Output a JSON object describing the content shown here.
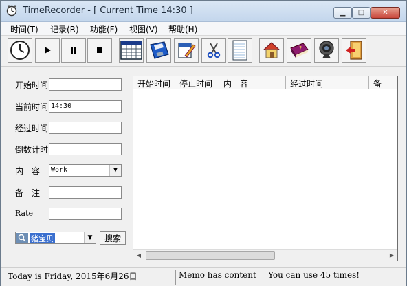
{
  "window": {
    "title": "TimeRecorder - [ Current Time 14:30 ]"
  },
  "window_controls": {
    "minimize": "▁",
    "maximize": "□",
    "close": "✕"
  },
  "menu": [
    "时间(T)",
    "记录(R)",
    "功能(F)",
    "视图(V)",
    "帮助(H)"
  ],
  "toolbar": {
    "buttons": [
      "clock-icon",
      "play-icon",
      "pause-icon",
      "stop-icon",
      "calendar-icon",
      "save-disk-icon",
      "edit-icon",
      "scissors-icon",
      "notebook-icon",
      "home-icon",
      "book-icon",
      "webcam-icon",
      "exit-door-icon"
    ],
    "colors": {
      "button_bg": "#f4f4f4"
    }
  },
  "form": {
    "start_time_label": "开始时间",
    "start_time_value": "",
    "current_time_label": "当前时间",
    "current_time_value": "14:30",
    "elapsed_label": "经过时间",
    "elapsed_value": "",
    "countdown_label": "倒数计时",
    "countdown_value": "",
    "content_label": "内　容",
    "content_value": "Work",
    "memo_label": "备　注",
    "memo_value": "",
    "rate_label": "Rate",
    "rate_value": "",
    "search_text": "猪宝贝",
    "search_button": "搜索"
  },
  "list": {
    "columns": [
      "开始时间",
      "停止时间",
      "内　容",
      "经过时间",
      "备"
    ],
    "rows": []
  },
  "status": {
    "today": "Today is Friday, 2015年6月26日",
    "memo": "Memo has content",
    "uses": "You can use 45 times!"
  }
}
